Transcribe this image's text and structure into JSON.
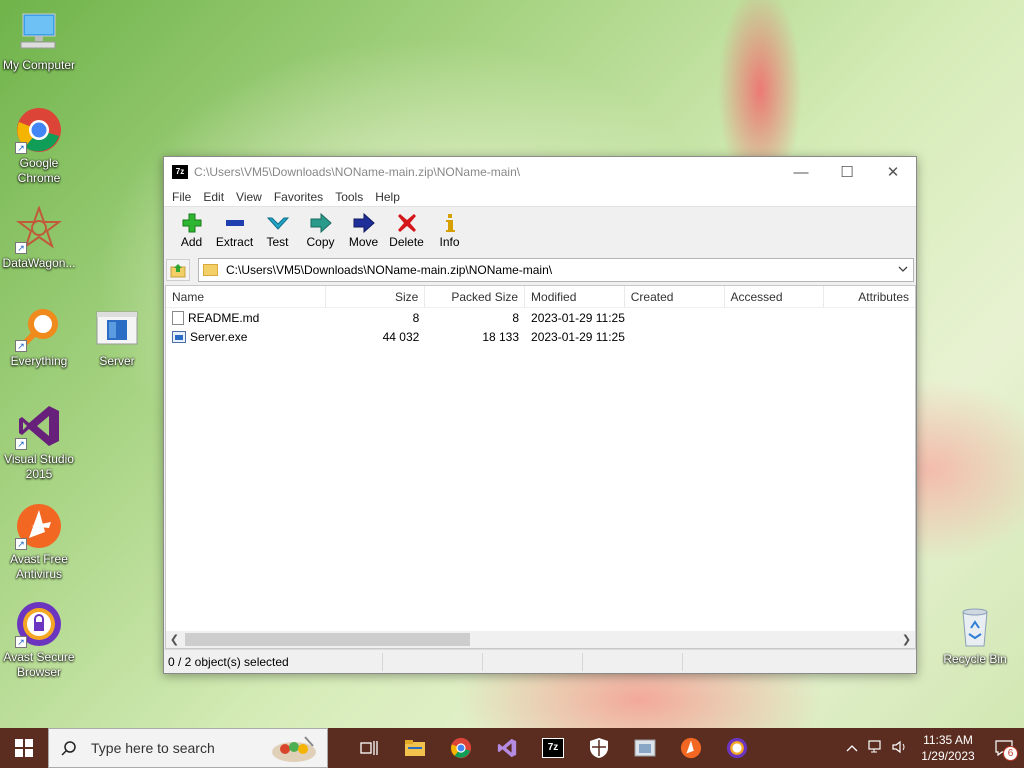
{
  "desktop": {
    "icons": [
      {
        "label": "My Computer",
        "icon": "computer-icon"
      },
      {
        "label": "Google Chrome",
        "icon": "chrome-icon"
      },
      {
        "label": "DataWagon...",
        "icon": "datawagon-icon"
      },
      {
        "label": "Everything",
        "icon": "everything-search-icon"
      },
      {
        "label": "Server",
        "icon": "server-window-icon"
      },
      {
        "label": "Visual Studio 2015",
        "icon": "visual-studio-icon"
      },
      {
        "label": "Avast Free Antivirus",
        "icon": "avast-antivirus-icon"
      },
      {
        "label": "Avast Secure Browser",
        "icon": "avast-browser-icon"
      },
      {
        "label": "Recycle Bin",
        "icon": "recycle-bin-icon"
      }
    ]
  },
  "window": {
    "app_icon_text": "7z",
    "title": "C:\\Users\\VM5\\Downloads\\NOName-main.zip\\NOName-main\\",
    "controls": {
      "minimize": "—",
      "maximize": "☐",
      "close": "✕"
    },
    "menu": [
      "File",
      "Edit",
      "View",
      "Favorites",
      "Tools",
      "Help"
    ],
    "toolbar": [
      {
        "label": "Add",
        "icon": "add-plus-icon",
        "color": "#2fb52f"
      },
      {
        "label": "Extract",
        "icon": "extract-minus-icon",
        "color": "#1f3fb0"
      },
      {
        "label": "Test",
        "icon": "test-check-icon",
        "color": "#20a5c8"
      },
      {
        "label": "Copy",
        "icon": "copy-arrow-icon",
        "color": "#2a9a8a"
      },
      {
        "label": "Move",
        "icon": "move-arrow-icon",
        "color": "#1f2f9a"
      },
      {
        "label": "Delete",
        "icon": "delete-x-icon",
        "color": "#d4161b"
      },
      {
        "label": "Info",
        "icon": "info-icon",
        "color": "#d6a100"
      }
    ],
    "address": "C:\\Users\\VM5\\Downloads\\NOName-main.zip\\NOName-main\\",
    "columns": [
      "Name",
      "Size",
      "Packed Size",
      "Modified",
      "Created",
      "Accessed",
      "Attributes"
    ],
    "files": [
      {
        "name": "README.md",
        "size": "8",
        "packed": "8",
        "modified": "2023-01-29 11:25",
        "created": "",
        "accessed": "",
        "attributes": "",
        "icon": "text-file-icon"
      },
      {
        "name": "Server.exe",
        "size": "44 032",
        "packed": "18 133",
        "modified": "2023-01-29 11:25",
        "created": "",
        "accessed": "",
        "attributes": "",
        "icon": "exe-file-icon"
      }
    ],
    "status": [
      "0 / 2 object(s) selected",
      "",
      "",
      ""
    ]
  },
  "taskbar": {
    "search_placeholder": "Type here to search",
    "apps": [
      {
        "name": "task-view-icon",
        "glyph": "⧉"
      },
      {
        "name": "file-explorer-icon",
        "glyph": ""
      },
      {
        "name": "chrome-taskbar-icon",
        "glyph": ""
      },
      {
        "name": "visual-studio-taskbar-icon",
        "glyph": ""
      },
      {
        "name": "7zip-taskbar-icon",
        "glyph": "7z"
      },
      {
        "name": "security-shield-icon",
        "glyph": ""
      },
      {
        "name": "server-taskbar-icon",
        "glyph": ""
      },
      {
        "name": "avast-taskbar-icon",
        "glyph": ""
      },
      {
        "name": "avast-browser-taskbar-icon",
        "glyph": ""
      }
    ],
    "time": "11:35 AM",
    "date": "1/29/2023",
    "notification_count": "6"
  }
}
